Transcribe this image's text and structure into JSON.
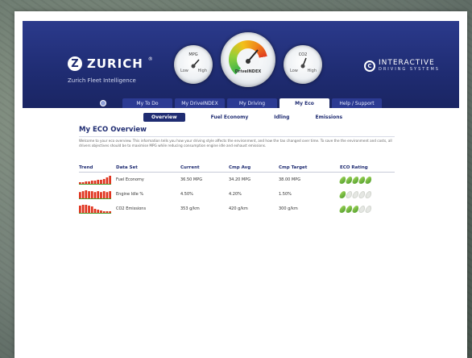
{
  "brand": {
    "logo_mark": "Z",
    "logo_word": "ZURICH",
    "logo_reg": "®",
    "subtitle": "Zurich Fleet Intelligence",
    "partner_line1": "INTERACTIVE",
    "partner_line2": "DRIVING SYSTEMS"
  },
  "gauges": {
    "left_label": "MPG",
    "main_label": "DriveINDEX",
    "right_label": "CO2",
    "low": "Low",
    "high": "High"
  },
  "nav": {
    "tabs": [
      {
        "label": "My To Do"
      },
      {
        "label": "My DriveINDEX"
      },
      {
        "label": "My Driving"
      },
      {
        "label": "My Eco",
        "active": true
      },
      {
        "label": "Help / Support"
      }
    ]
  },
  "subnav": {
    "items": [
      {
        "label": "Overview",
        "active": true
      },
      {
        "label": "Fuel Economy"
      },
      {
        "label": "Idling"
      },
      {
        "label": "Emissions"
      }
    ]
  },
  "main": {
    "title": "My ECO Overview",
    "intro": "Welcome to your eco overview. This information tells you how your driving style affects the environment, and how the tax changed over time. To save the the environment and costs, all drivers objectives should be to maximise MPG while reducing consumption engine idle and exhaust emissions."
  },
  "table": {
    "headers": [
      "Trend",
      "Data Set",
      "Current",
      "Cmp Avg",
      "Cmp Target",
      "ECO Rating"
    ],
    "rows": [
      {
        "data_set": "Fuel Economy",
        "current": "36.50 MPG",
        "cmp_avg": "34.20 MPG",
        "cmp_target": "38.00 MPG",
        "rating": 5,
        "trend": [
          2,
          2,
          3,
          3,
          4,
          4,
          5,
          5,
          6,
          8,
          10
        ]
      },
      {
        "data_set": "Engine Idle %",
        "current": "4.50%",
        "cmp_avg": "4.20%",
        "cmp_target": "1.50%",
        "rating": 1,
        "trend": [
          7,
          8,
          9,
          8,
          8,
          7,
          8,
          7,
          8,
          7,
          8
        ]
      },
      {
        "data_set": "CO2 Emissions",
        "current": "353 g/km",
        "cmp_avg": "420 g/km",
        "cmp_target": "300 g/km",
        "rating": 3,
        "trend": [
          9,
          10,
          10,
          9,
          8,
          5,
          4,
          3,
          2,
          2,
          2
        ]
      }
    ],
    "rating_max": 5
  },
  "colors": {
    "header_blue": "#1f2c72",
    "trend_red": "#e0341f",
    "trend_baseline": "#4c9b2a"
  }
}
